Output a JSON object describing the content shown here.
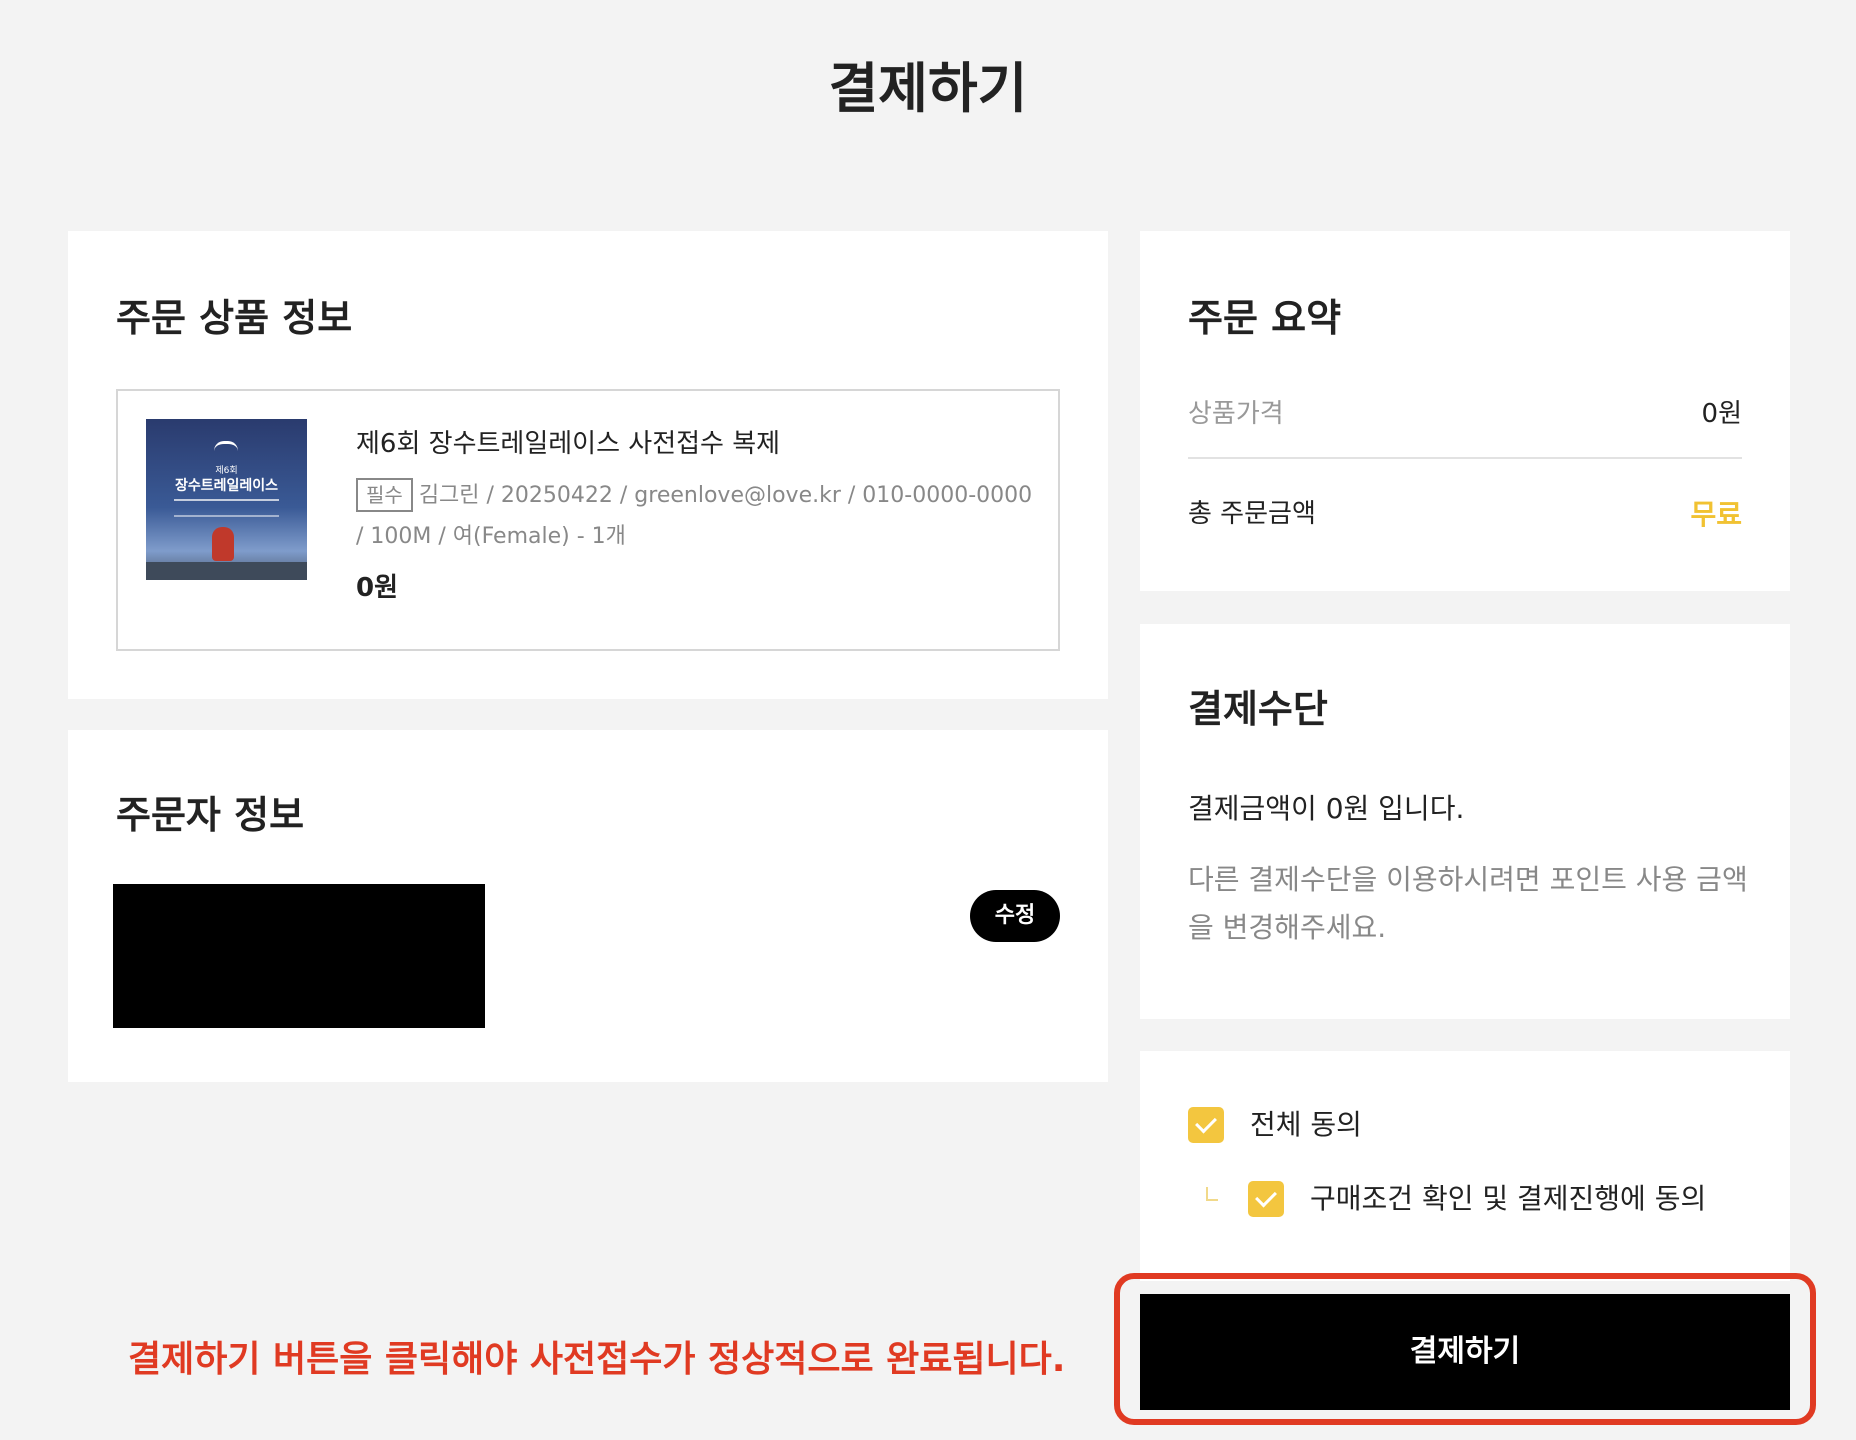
{
  "page": {
    "title": "결제하기"
  },
  "product_section": {
    "title": "주문 상품 정보",
    "thumbnail": {
      "line1": "제6회",
      "line2": "장수트레일레이스"
    },
    "name": "제6회 장수트레일레이스 사전접수 복제",
    "required_badge": "필수",
    "detail_line1": "김그린 / 20250422 / greenlove@love.kr / 010-0000-0000",
    "detail_line2": "/ 100M / 여(Female) - 1개",
    "price": "0원"
  },
  "orderer_section": {
    "title": "주문자 정보",
    "edit_label": "수정"
  },
  "summary_section": {
    "title": "주문 요약",
    "price_label": "상품가격",
    "price_value": "0원",
    "total_label": "총 주문금액",
    "total_value": "무료"
  },
  "payment_section": {
    "title": "결제수단",
    "amount_text": "결제금액이 0원 입니다.",
    "note_text": "다른 결제수단을 이용하시려면 포인트 사용 금액을 변경해주세요."
  },
  "agreement_section": {
    "agree_all_label": "전체 동의",
    "agree_all_checked": true,
    "agree_terms_label": "구매조건 확인 및 결제진행에 동의",
    "agree_terms_checked": true
  },
  "pay_button": {
    "label": "결제하기"
  },
  "notice": {
    "text": "결제하기 버튼을 클릭해야 사전접수가 정상적으로 완료됩니다."
  },
  "colors": {
    "accent_yellow": "#f1c232",
    "notice_red": "#e03a22",
    "button_black": "#000000",
    "background": "#f3f3f3"
  }
}
